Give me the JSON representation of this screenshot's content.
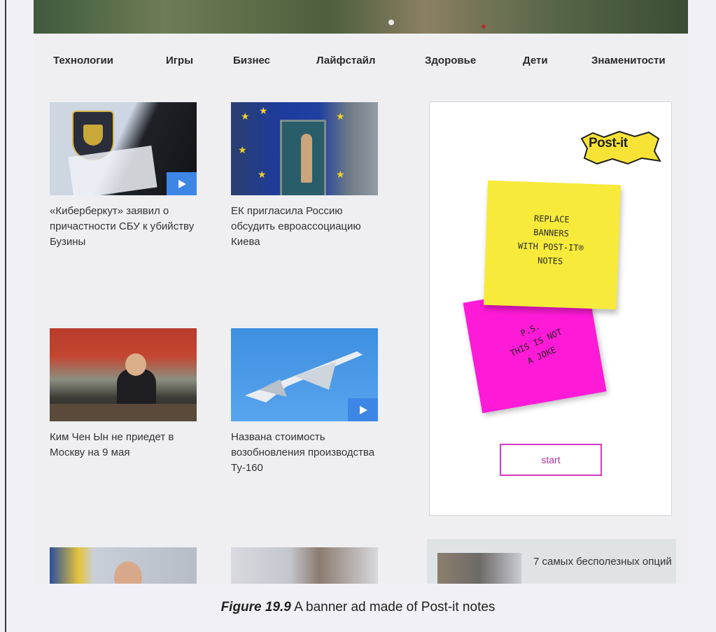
{
  "nav": {
    "items": [
      "Технологии",
      "Игры",
      "Бизнес",
      "Лайфстайл",
      "Здоровье",
      "Дети",
      "Знаменитости"
    ]
  },
  "articles": [
    {
      "title": "«Киберберкут» заявил о причастности СБУ к убийству Бузины",
      "has_video": true
    },
    {
      "title": "ЕК пригласила Россию обсудить евроассоциацию Киева",
      "has_video": false
    },
    {
      "title": "Ким Чен Ын не приедет в Москву на 9 мая",
      "has_video": false
    },
    {
      "title": "Названа стоимость возобновления производства Ту-160",
      "has_video": true
    }
  ],
  "bottom_teaser": {
    "text": "7 самых бесполезных опций"
  },
  "ad": {
    "logo": "Post-it",
    "yellow_note_lines": [
      "REPLACE",
      "BANNERS",
      "WITH POST-IT®",
      "NOTES"
    ],
    "pink_note_lines": [
      "P.S.",
      "THIS IS NOT",
      "A JOKE"
    ],
    "button_label": "start",
    "colors": {
      "yellow": "#f7ea3b",
      "pink": "#ff1ad8",
      "button_border": "#d23ac0"
    }
  },
  "caption": {
    "label": "Figure 19.9",
    "text": " A banner ad made of Post-it notes"
  }
}
